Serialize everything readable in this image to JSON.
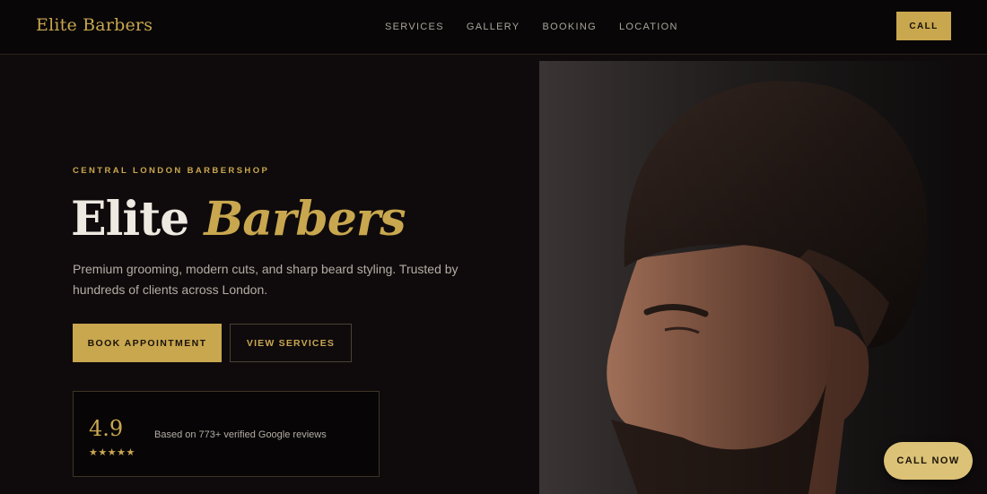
{
  "header": {
    "brand": "Elite Barbers",
    "nav": [
      "SERVICES",
      "GALLERY",
      "BOOKING",
      "LOCATION"
    ],
    "call_label": "CALL"
  },
  "hero": {
    "eyebrow": "CENTRAL LONDON BARBERSHOP",
    "title_main": "Elite",
    "title_accent": "Barbers",
    "description": "Premium grooming, modern cuts, and sharp beard styling. Trusted by hundreds of clients across London.",
    "primary_button": "BOOK APPOINTMENT",
    "secondary_button": "VIEW SERVICES"
  },
  "rating": {
    "score": "4.9",
    "stars": "★★★★★",
    "text": "Based on 773+ verified Google reviews"
  },
  "floating_button": "CALL NOW",
  "colors": {
    "accent": "#c9a74f",
    "background": "#0f0b0c",
    "header": "#080607"
  }
}
